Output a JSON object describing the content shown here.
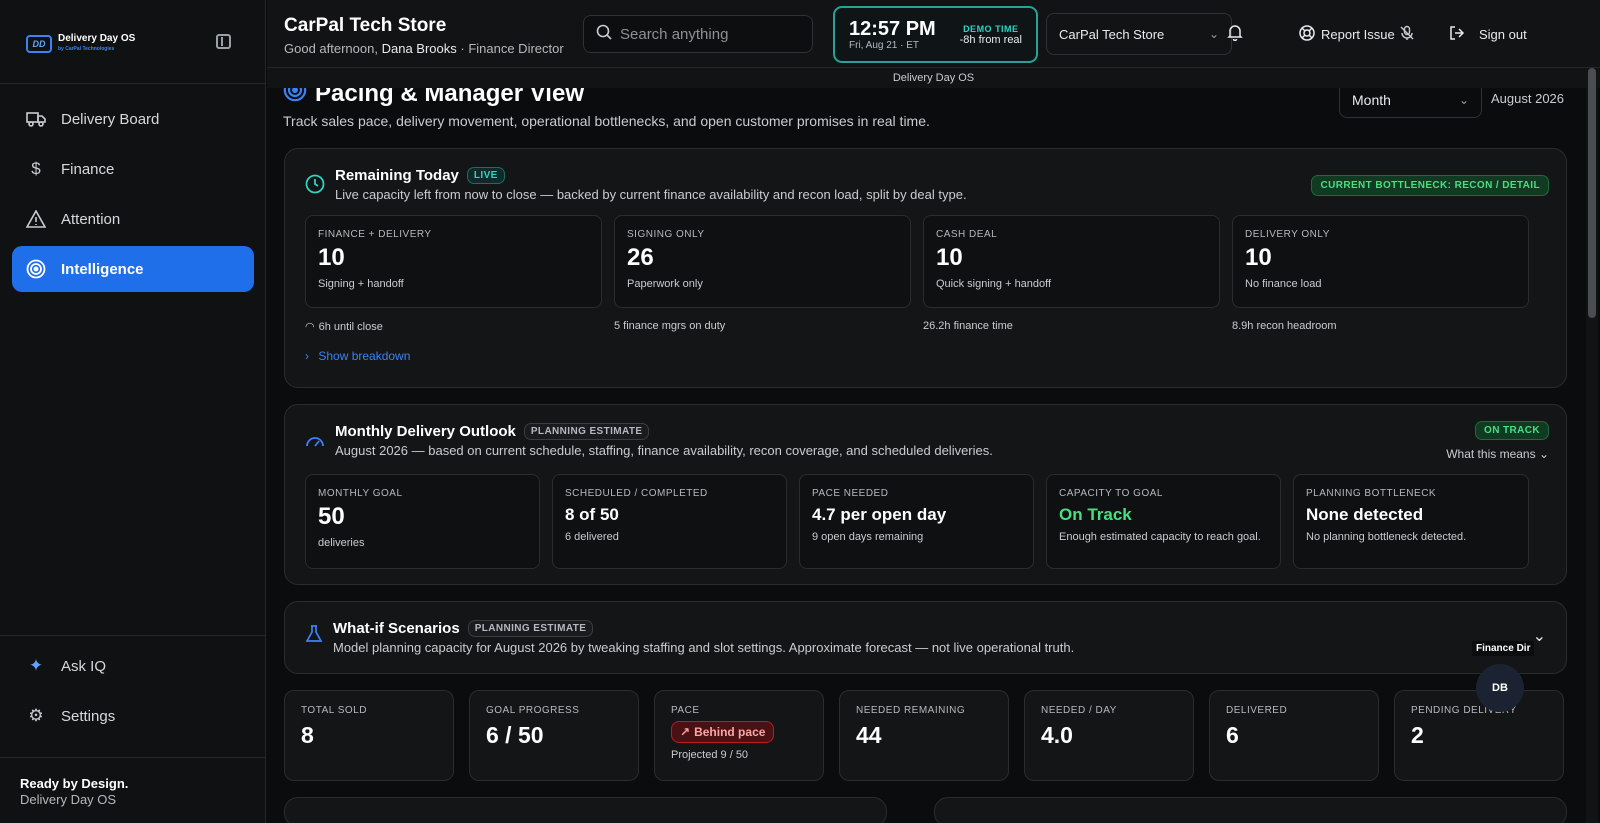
{
  "sidebar": {
    "logo_text": "Delivery Day OS",
    "logo_mark": "DD",
    "logo_sub": "by CarPal Technologies",
    "items": [
      {
        "label": "Delivery Board",
        "icon": "truck-icon"
      },
      {
        "label": "Finance",
        "icon": "dollar-icon"
      },
      {
        "label": "Attention",
        "icon": "warning-icon"
      },
      {
        "label": "Intelligence",
        "icon": "target-icon"
      }
    ],
    "bottom": [
      {
        "label": "Ask IQ",
        "icon": "sparkle-icon"
      },
      {
        "label": "Settings",
        "icon": "gear-icon"
      }
    ],
    "footer_title": "Ready by Design.",
    "footer_sub": "Delivery Day OS"
  },
  "header": {
    "store_title": "CarPal Tech Store",
    "greeting_prefix": "Good afternoon,",
    "user_name": "Dana Brooks",
    "user_role": "· Finance Director",
    "search_placeholder": "Search anything",
    "clock_time": "12:57 PM",
    "clock_date": "Fri, Aug 21 · ET",
    "demo_label": "DEMO TIME",
    "demo_offset": "-8h from real",
    "store_select": "CarPal Tech Store",
    "report_issue": "Report Issue",
    "sign_out": "Sign out",
    "subheader": "Delivery Day OS"
  },
  "page": {
    "title": "Pacing & Manager View",
    "subtitle": "Track sales pace, delivery movement, operational bottlenecks, and open customer promises in real time.",
    "period": "Month",
    "period_label": "August 2026"
  },
  "remaining": {
    "title": "Remaining Today",
    "badge": "LIVE",
    "desc": "Live capacity left from now to close — backed by current finance availability and recon load, split by deal type.",
    "bottleneck": "CURRENT BOTTLENECK: RECON / DETAIL",
    "metrics": [
      {
        "label": "FINANCE + DELIVERY",
        "value": "10",
        "note": "Signing + handoff"
      },
      {
        "label": "SIGNING ONLY",
        "value": "26",
        "note": "Paperwork only"
      },
      {
        "label": "CASH DEAL",
        "value": "10",
        "note": "Quick signing + handoff"
      },
      {
        "label": "DELIVERY ONLY",
        "value": "10",
        "note": "No finance load"
      }
    ],
    "footnotes": [
      "6h until close",
      "5 finance mgrs on duty",
      "26.2h finance time",
      "8.9h recon headroom"
    ],
    "show_breakdown": "Show breakdown"
  },
  "outlook": {
    "title": "Monthly Delivery Outlook",
    "badge": "PLANNING ESTIMATE",
    "desc": "August 2026 — based on current schedule, staffing, finance availability, recon coverage, and scheduled deliveries.",
    "status": "ON TRACK",
    "what_means": "What this means",
    "metrics": [
      {
        "label": "MONTHLY GOAL",
        "value": "50",
        "note": "deliveries"
      },
      {
        "label": "SCHEDULED / COMPLETED",
        "value": "8 of 50",
        "note": "6 delivered"
      },
      {
        "label": "PACE NEEDED",
        "value": "4.7 per open day",
        "note": "9 open days remaining"
      },
      {
        "label": "CAPACITY TO GOAL",
        "value": "On Track",
        "note": "Enough estimated capacity to reach goal."
      },
      {
        "label": "PLANNING BOTTLENECK",
        "value": "None detected",
        "note": "No planning bottleneck detected."
      }
    ]
  },
  "whatif": {
    "title": "What-if Scenarios",
    "badge": "PLANNING ESTIMATE",
    "desc": "Model planning capacity for August 2026 by tweaking staffing and slot settings. Approximate forecast — not live operational truth."
  },
  "stats": [
    {
      "label": "TOTAL SOLD",
      "value": "8"
    },
    {
      "label": "GOAL PROGRESS",
      "value": "6 / 50"
    },
    {
      "label": "PACE",
      "pill": "Behind pace",
      "note": "Projected 9 / 50"
    },
    {
      "label": "NEEDED REMAINING",
      "value": "44"
    },
    {
      "label": "NEEDED / DAY",
      "value": "4.0"
    },
    {
      "label": "DELIVERED",
      "value": "6"
    },
    {
      "label": "PENDING DELIVERY",
      "value": "2"
    }
  ],
  "floating": {
    "role_label": "Finance Dir",
    "avatar_initials": "DB"
  },
  "colors": {
    "accent": "#1f6feb",
    "live": "#2dd4bf",
    "ok": "#4ade80",
    "danger": "#b91c1c"
  }
}
